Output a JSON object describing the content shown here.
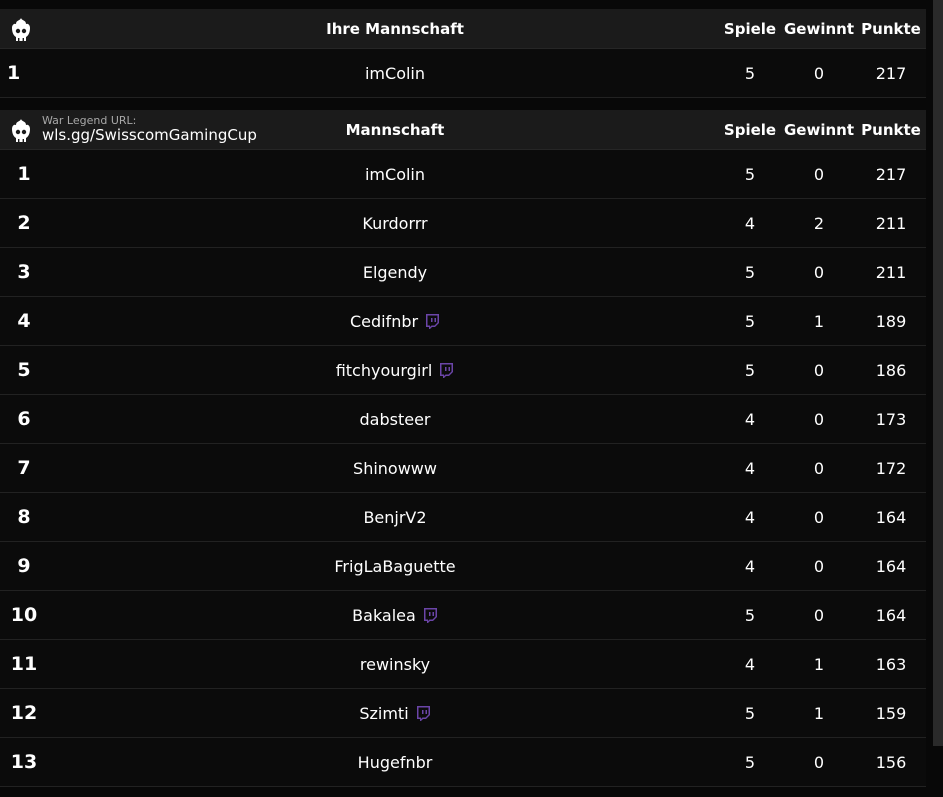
{
  "my_team": {
    "header": {
      "team": "Ihre Mannschaft",
      "games": "Spiele",
      "wins": "Gewinnt",
      "points": "Punkte"
    },
    "row": {
      "rank": "1",
      "name": "imColin",
      "games": "5",
      "wins": "0",
      "points": "217"
    }
  },
  "leaderboard": {
    "url_label": "War Legend URL:",
    "url_value": "wls.gg/SwisscomGamingCup",
    "header": {
      "team": "Mannschaft",
      "games": "Spiele",
      "wins": "Gewinnt",
      "points": "Punkte"
    },
    "rows": [
      {
        "rank": "1",
        "name": "imColin",
        "games": "5",
        "wins": "0",
        "points": "217",
        "twitch": false
      },
      {
        "rank": "2",
        "name": "Kurdorrr",
        "games": "4",
        "wins": "2",
        "points": "211",
        "twitch": false
      },
      {
        "rank": "3",
        "name": "Elgendy",
        "games": "5",
        "wins": "0",
        "points": "211",
        "twitch": false
      },
      {
        "rank": "4",
        "name": "Cedifnbr",
        "games": "5",
        "wins": "1",
        "points": "189",
        "twitch": true
      },
      {
        "rank": "5",
        "name": "fitchyourgirl",
        "games": "5",
        "wins": "0",
        "points": "186",
        "twitch": true
      },
      {
        "rank": "6",
        "name": "dabsteer",
        "games": "4",
        "wins": "0",
        "points": "173",
        "twitch": false
      },
      {
        "rank": "7",
        "name": "Shinowww",
        "games": "4",
        "wins": "0",
        "points": "172",
        "twitch": false
      },
      {
        "rank": "8",
        "name": "BenjrV2",
        "games": "4",
        "wins": "0",
        "points": "164",
        "twitch": false
      },
      {
        "rank": "9",
        "name": "FrigLaBaguette",
        "games": "4",
        "wins": "0",
        "points": "164",
        "twitch": false
      },
      {
        "rank": "10",
        "name": "Bakalea",
        "games": "5",
        "wins": "0",
        "points": "164",
        "twitch": true
      },
      {
        "rank": "11",
        "name": "rewinsky",
        "games": "4",
        "wins": "1",
        "points": "163",
        "twitch": false
      },
      {
        "rank": "12",
        "name": "Szimti",
        "games": "5",
        "wins": "1",
        "points": "159",
        "twitch": true
      },
      {
        "rank": "13",
        "name": "Hugefnbr",
        "games": "5",
        "wins": "0",
        "points": "156",
        "twitch": false
      }
    ]
  },
  "icons": {
    "logo": "flame-skull-logo-icon",
    "twitch": "twitch-icon"
  },
  "colors": {
    "background": "#080808",
    "header": "#1b1b1b",
    "twitch": "#6b45a8"
  }
}
